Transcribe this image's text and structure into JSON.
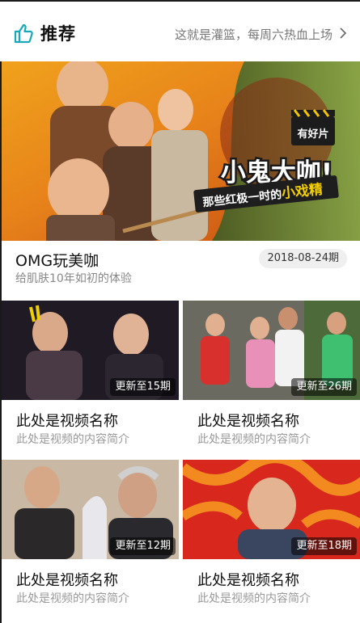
{
  "header": {
    "title": "推荐",
    "subtitle": "这就是灌篮，每周六热血上场",
    "icon": "thumbs-up-icon",
    "accent": "#1aa8b8"
  },
  "banner": {
    "headline": "小鬼大咖!",
    "tagline_prefix": "那些红极一时的",
    "tagline_highlight": "小戏精",
    "logo_text": "有好片"
  },
  "featured": {
    "title": "OMG玩美咖",
    "desc": "给肌肤10年如初的体验",
    "date": "2018-08-24期"
  },
  "videos": [
    {
      "name": "此处是视频名称",
      "desc": "此处是视频的内容简介",
      "badge": "更新至15期"
    },
    {
      "name": "此处是视频名称",
      "desc": "此处是视频的内容简介",
      "badge": "更新至26期"
    },
    {
      "name": "此处是视频名称",
      "desc": "此处是视频的内容简介",
      "badge": "更新至12期"
    },
    {
      "name": "此处是视频名称",
      "desc": "此处是视频的内容简介",
      "badge": "更新至18期"
    }
  ]
}
